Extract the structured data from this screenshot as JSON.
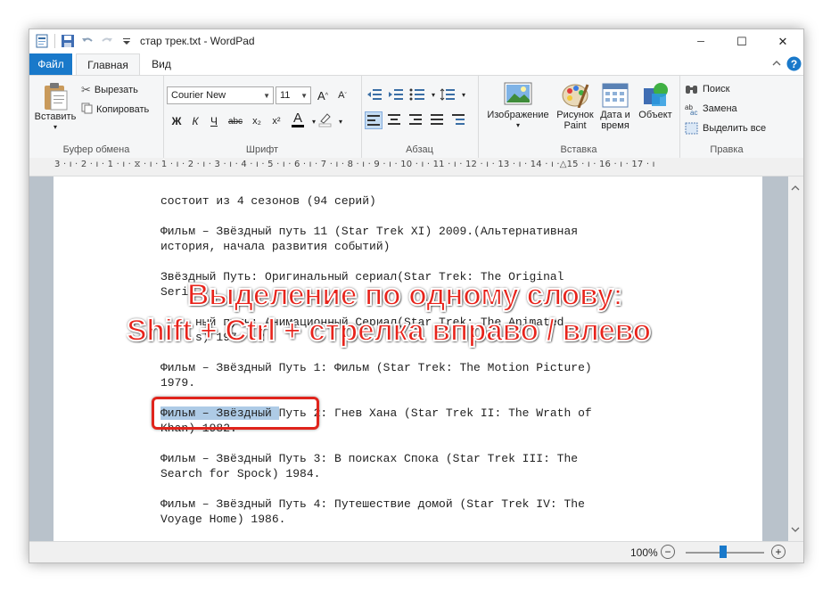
{
  "window": {
    "title": "стар трек.txt - WordPad",
    "controls": {
      "minimize": "─",
      "maximize": "☐",
      "close": "✕"
    }
  },
  "tabs": [
    {
      "label": "Файл"
    },
    {
      "label": "Главная"
    },
    {
      "label": "Вид"
    }
  ],
  "ribbon": {
    "clipboard": {
      "label": "Буфер обмена",
      "paste": "Вставить",
      "cut": "Вырезать",
      "copy": "Копировать"
    },
    "font": {
      "label": "Шрифт",
      "family": "Courier New",
      "size": "11",
      "bold": "Ж",
      "italic": "К",
      "underline": "Ч",
      "strike": "abc",
      "subscript": "x₂",
      "superscript": "x²",
      "color_letter": "A"
    },
    "paragraph": {
      "label": "Абзац"
    },
    "insert": {
      "label": "Вставка",
      "image": "Изображение",
      "paint": "Рисунок Paint",
      "datetime": "Дата и время",
      "object": "Объект"
    },
    "editing": {
      "label": "Правка",
      "find": "Поиск",
      "replace": "Замена",
      "select_all": "Выделить все"
    }
  },
  "ruler": {
    "text": "3 · ı · 2 · ı · 1 · ı · ⧖ · ı · 1 · ı · 2 · ı · 3 · ı · 4 · ı · 5 · ı · 6 · ı · 7 · ı · 8 · ı · 9 · ı · 10 · ı · 11 · ı · 12 · ı · 13 · ı · 14 · ı ·△15 · ı · 16 · ı · 17 · ı"
  },
  "document": {
    "lines": [
      "состоит из 4 сезонов (94 серий)",
      "Фильм – Звёздный путь 11 (Star Trek XI) 2009.(Альтернативная",
      "история, начала развития событий)",
      "Звёздный Путь: Оригинальный сериал(Star Trek: The Original",
      "Seri                                         ",
      "     ный путь: Анимационный Сериал(Star Trek: The Animated",
      "     s) 197   2                  ",
      "Фильм – Звёздный Путь 1: Фильм (Star Trek: The Motion Picture)",
      "1979.",
      "Путь 2: Гнев Хана (Star Trek II: The Wrath of",
      "Khan) 1982.",
      "Фильм – Звёздный Путь 3: В поисках Спока (Star Trek III: The",
      "Search for Spock) 1984.",
      "Фильм – Звёздный Путь 4: Путешествие домой (Star Trek IV: The",
      "Voyage Home) 1986."
    ],
    "selected_text": "Фильм – Звёздный "
  },
  "status": {
    "zoom": "100%",
    "zoom_out": "−",
    "zoom_in": "+",
    "zoom_level_percent": 100
  },
  "overlay": {
    "line1": "Выделение по одному слову:",
    "line2": "Shift + Ctrl + стрелка вправо / влево"
  },
  "colors": {
    "file_tab": "#1979ca",
    "selection": "#aecbe6",
    "callout": "#e0241c",
    "caption": "#e8231b"
  }
}
